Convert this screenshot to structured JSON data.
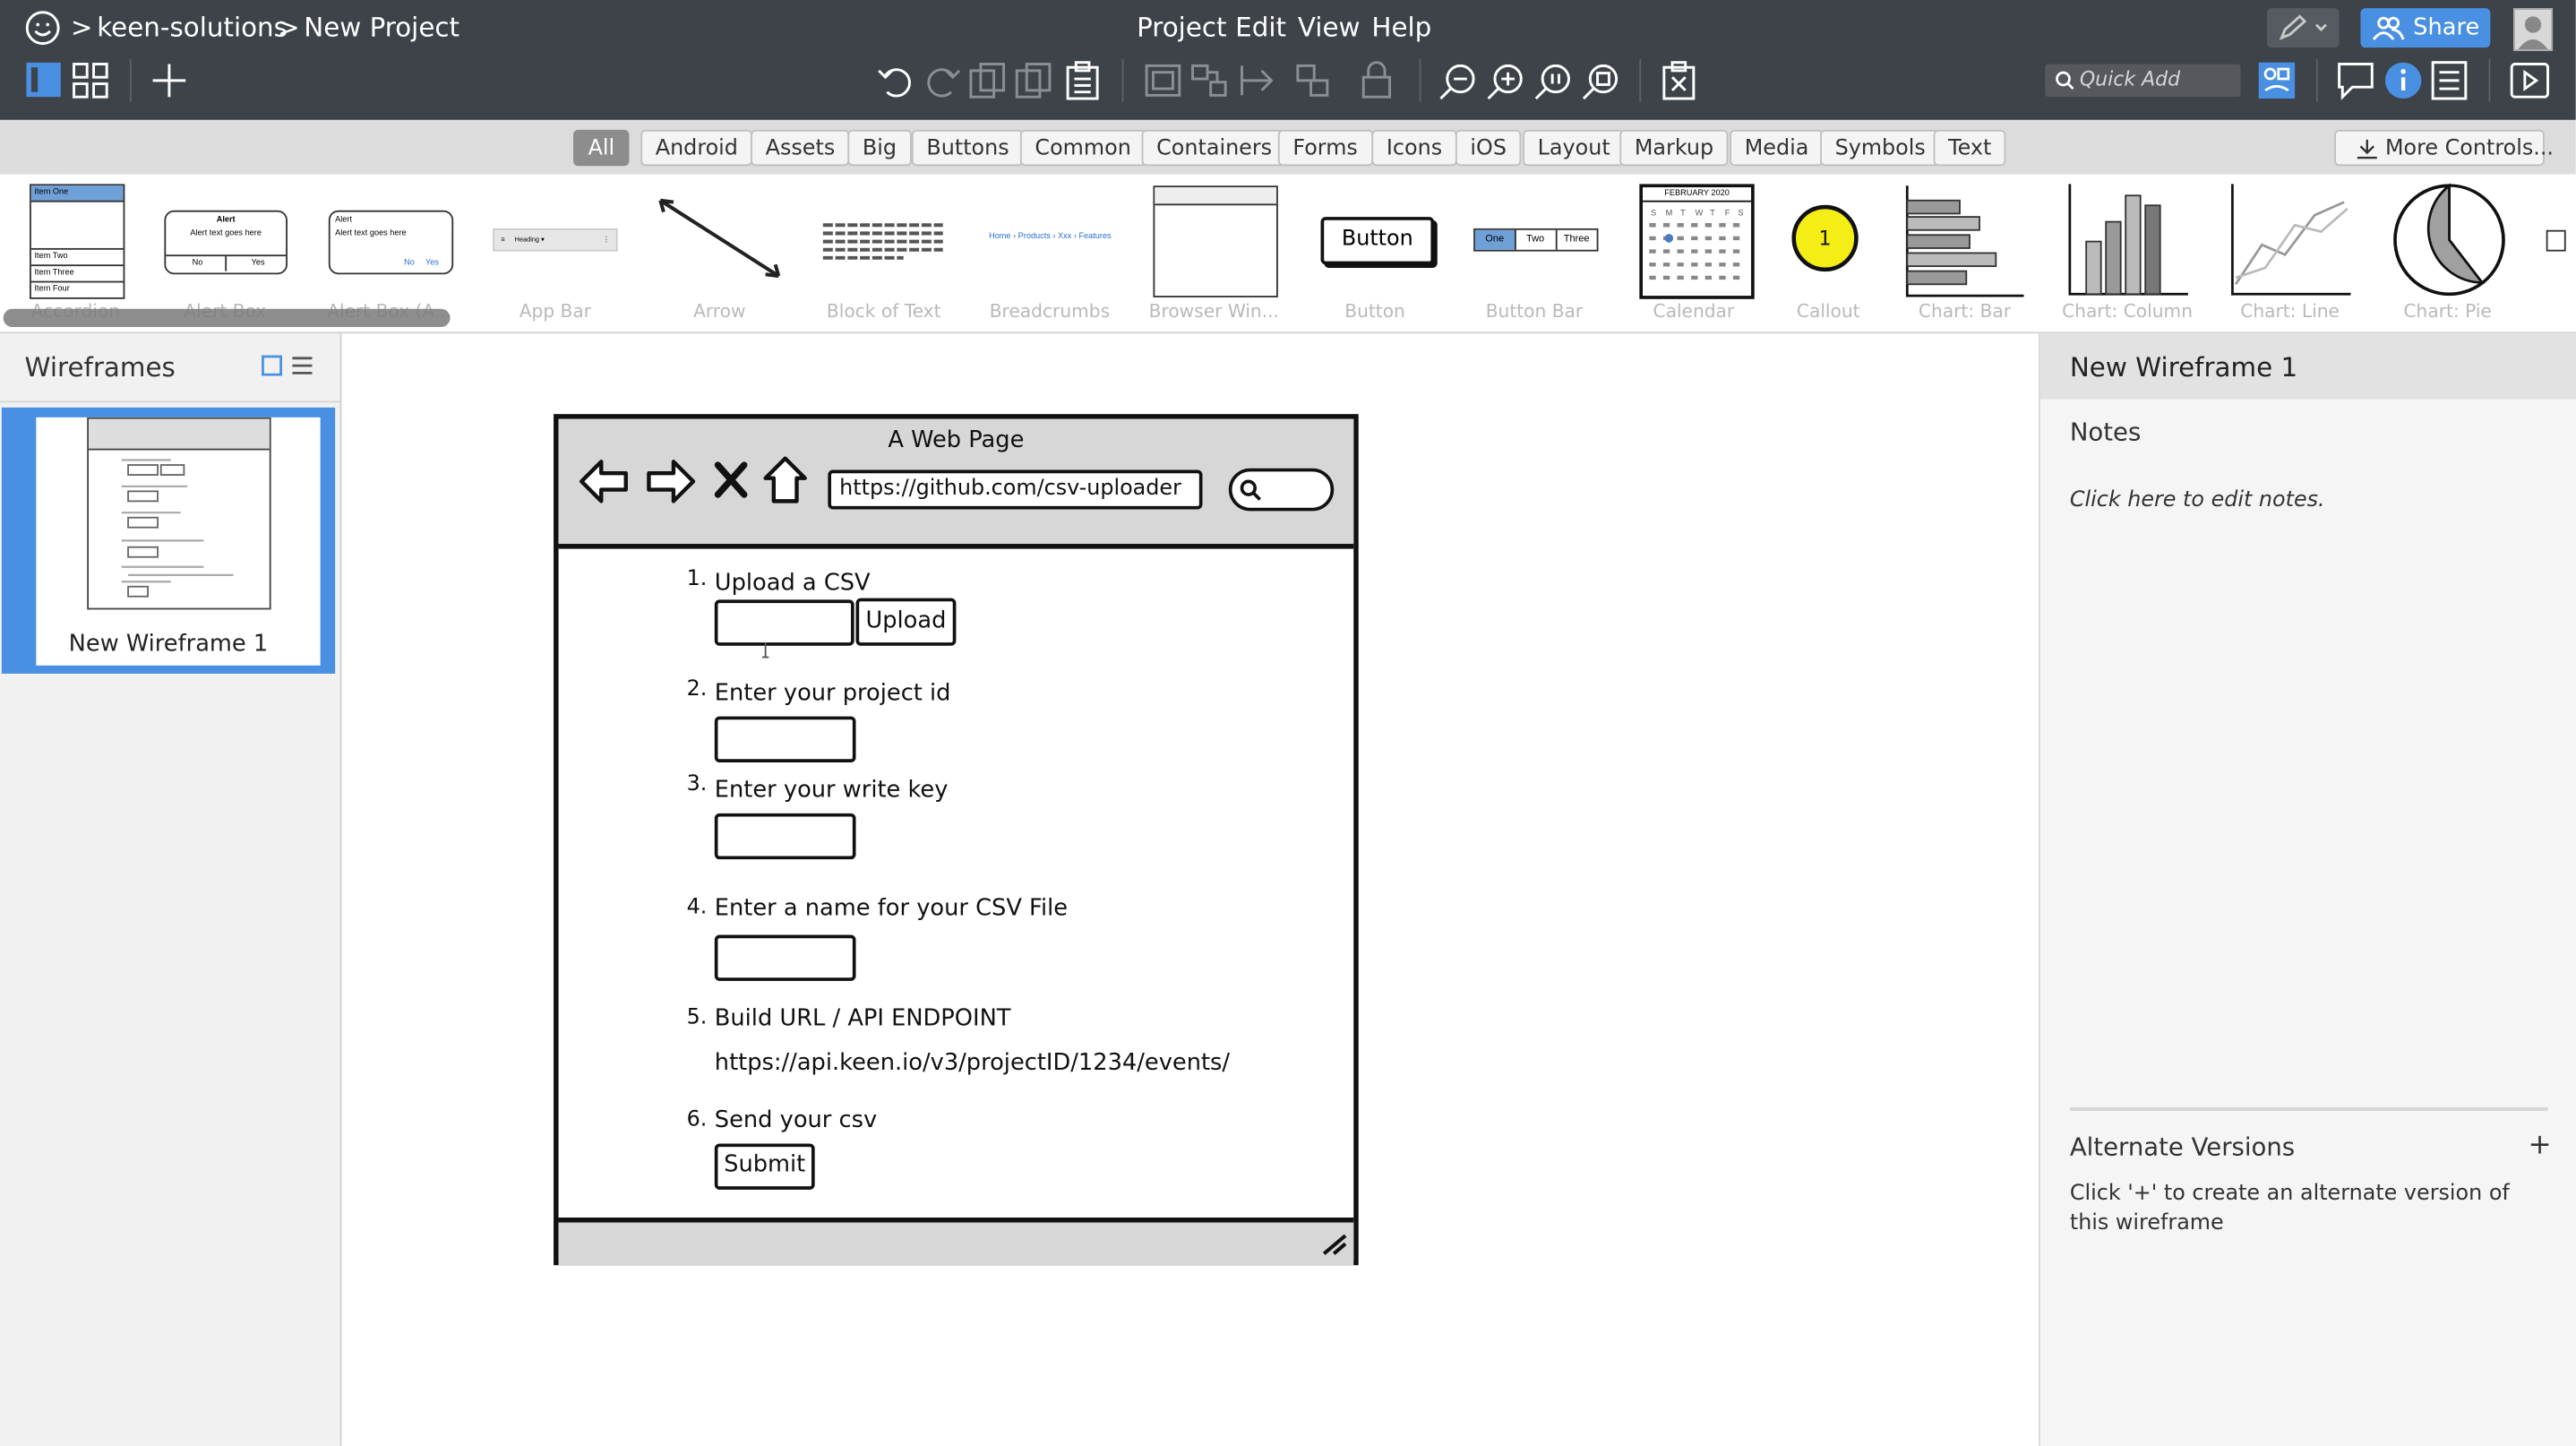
{
  "topbar": {
    "breadcrumb_sep": ">",
    "project_owner": "keen-solutions",
    "project_name": "New Project",
    "menus": [
      "Project",
      "Edit",
      "View",
      "Help"
    ],
    "share_label": "Share",
    "quick_add_placeholder": "Quick Add"
  },
  "filters": {
    "chips": [
      "All",
      "Android",
      "Assets",
      "Big",
      "Buttons",
      "Common",
      "Containers",
      "Forms",
      "Icons",
      "iOS",
      "Layout",
      "Markup",
      "Media",
      "Symbols",
      "Text"
    ],
    "active": "All",
    "more_controls": "More Controls..."
  },
  "library": {
    "items": [
      "Accordion",
      "Alert Box",
      "Alert Box (A...",
      "App Bar",
      "Arrow",
      "Block of Text",
      "Breadcrumbs",
      "Browser Win...",
      "Button",
      "Button Bar",
      "Calendar",
      "Callout",
      "Chart: Bar",
      "Chart: Column",
      "Chart: Line",
      "Chart: Pie"
    ],
    "accordion_items": [
      "Item One",
      "Item Two",
      "Item Three",
      "Item Four"
    ],
    "alert_title": "Alert",
    "alert_text": "Alert text goes here",
    "alert_no": "No",
    "alert_yes": "Yes",
    "appbar_heading": "Heading",
    "breadcrumbs_text": "Home › Products › Xxx › Features",
    "button_text": "Button",
    "buttonbar": [
      "One",
      "Two",
      "Three"
    ],
    "calendar_title": "FEBRUARY 2020",
    "callout_num": "1"
  },
  "left": {
    "title": "Wireframes",
    "wireframe_name": "New Wireframe 1"
  },
  "wireframe": {
    "window_title": "A Web Page",
    "url": "https://github.com/csv-uploader",
    "steps": [
      {
        "num": "1.",
        "label": "Upload a CSV"
      },
      {
        "num": "2.",
        "label": "Enter your project id"
      },
      {
        "num": "3.",
        "label": "Enter your write key"
      },
      {
        "num": "4.",
        "label": "Enter a name for your CSV File"
      },
      {
        "num": "5.",
        "label": "Build URL / API ENDPOINT"
      },
      {
        "num": "6.",
        "label": "Send your csv"
      }
    ],
    "upload_button": "Upload",
    "endpoint": "https://api.keen.io/v3/projectID/1234/events/",
    "submit_button": "Submit"
  },
  "right": {
    "title": "New Wireframe 1",
    "notes_heading": "Notes",
    "notes_hint": "Click here to edit notes.",
    "alt_heading": "Alternate Versions",
    "alt_add": "+",
    "alt_hint": "Click '+' to create an alternate version of this wireframe"
  }
}
